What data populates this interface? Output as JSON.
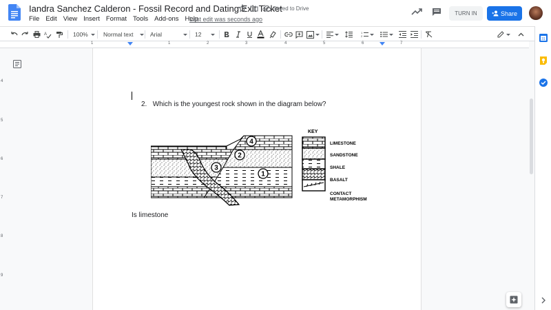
{
  "doc": {
    "title": "Iandra Sanchez Calderon - Fossil Record and Dating Exit Ticket",
    "saved_status": "Saved to Drive",
    "last_edit": "Last edit was seconds ago"
  },
  "menu": [
    "File",
    "Edit",
    "View",
    "Insert",
    "Format",
    "Tools",
    "Add-ons",
    "Help"
  ],
  "header_actions": {
    "turn_in": "TURN IN",
    "share": "Share"
  },
  "toolbar": {
    "zoom": "100%",
    "style": "Normal text",
    "font": "Arial",
    "font_size": "12"
  },
  "ruler": {
    "numbers": [
      "1",
      "1",
      "2",
      "3",
      "4",
      "5",
      "6",
      "7"
    ]
  },
  "vruler": {
    "numbers": [
      "4",
      "5",
      "6",
      "7",
      "8",
      "9"
    ]
  },
  "content": {
    "question_number": "2.",
    "question_text": "Which is the youngest rock shown in the diagram below?",
    "answer": "Is  limestone"
  },
  "diagram": {
    "key_title": "KEY",
    "key_items": [
      "LIMESTONE",
      "SANDSTONE",
      "SHALE",
      "BASALT",
      "CONTACT",
      "METAMORPHISM"
    ],
    "circle_labels": [
      "4",
      "2",
      "3",
      "1"
    ]
  },
  "colors": {
    "share_blue": "#1a73e8",
    "text": "#202124",
    "muted": "#5f6368"
  }
}
